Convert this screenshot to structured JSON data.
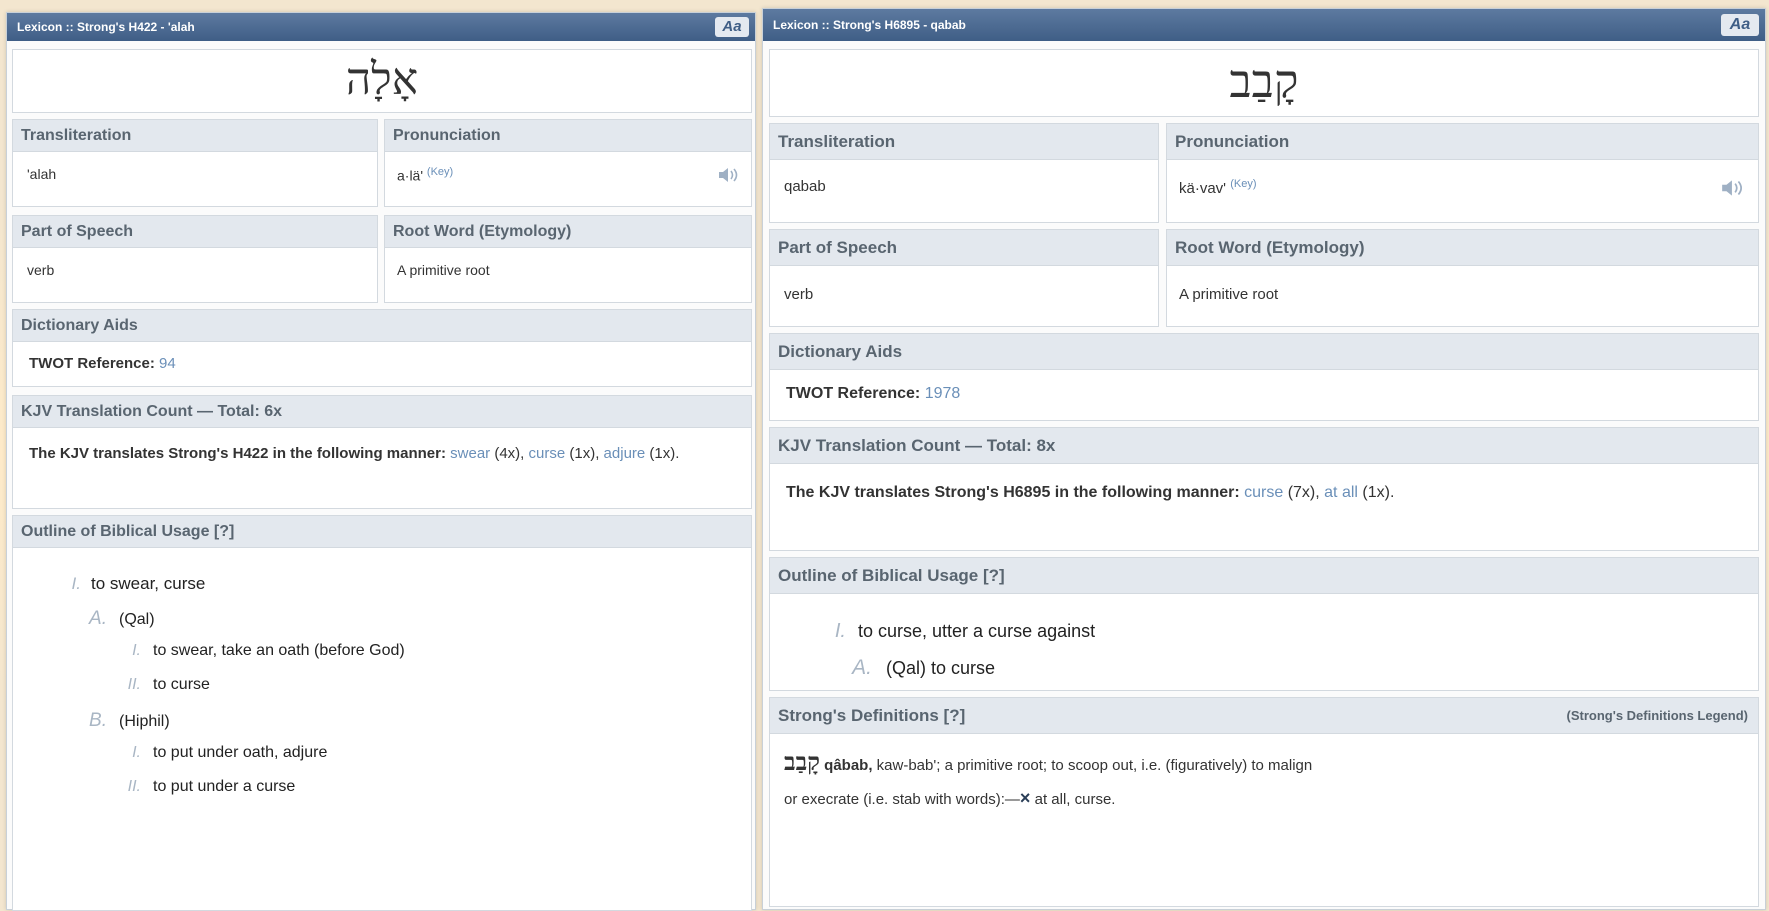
{
  "left": {
    "title": "Lexicon :: Strong's H422 - 'alah",
    "font_button": "Aa",
    "hebrew_word": "אָלָה",
    "transliteration_label": "Transliteration",
    "transliteration": "'alah",
    "pronunciation_label": "Pronunciation",
    "pronunciation": "a·lä'",
    "pronunciation_key": "(Key)",
    "pos_label": "Part of Speech",
    "pos": "verb",
    "root_label": "Root Word (Etymology)",
    "root": "A primitive root",
    "aids_label": "Dictionary Aids",
    "twot_label": "TWOT Reference:",
    "twot_value": "94",
    "kjv_label": "KJV Translation Count — Total: 6x",
    "kjv_intro": "The KJV translates Strong's H422 in the following manner:",
    "kjv_t1": "swear",
    "kjv_t1_count": " (4x),",
    "kjv_t2": "curse",
    "kjv_t2_count": " (1x),",
    "kjv_t3": "adjure",
    "kjv_t3_count": " (1x).",
    "outline_label": "Outline of Biblical Usage [?]",
    "outline": [
      {
        "num": "I.",
        "text": "to swear, curse"
      },
      {
        "num": "A.",
        "text": "(Qal)"
      },
      {
        "num": "I.",
        "text": "to swear, take an oath (before God)"
      },
      {
        "num": "II.",
        "text": "to curse"
      },
      {
        "num": "B.",
        "text": "(Hiphil)"
      },
      {
        "num": "I.",
        "text": "to put under oath, adjure"
      },
      {
        "num": "II.",
        "text": "to put under a curse"
      }
    ]
  },
  "right": {
    "title": "Lexicon :: Strong's H6895 - qabab",
    "font_button": "Aa",
    "hebrew_word": "קָבַב",
    "transliteration_label": "Transliteration",
    "transliteration": "qabab",
    "pronunciation_label": "Pronunciation",
    "pronunciation": "kä·vav'",
    "pronunciation_key": "(Key)",
    "pos_label": "Part of Speech",
    "pos": "verb",
    "root_label": "Root Word (Etymology)",
    "root": "A primitive root",
    "aids_label": "Dictionary Aids",
    "twot_label": "TWOT Reference:",
    "twot_value": "1978",
    "kjv_label": "KJV Translation Count — Total: 8x",
    "kjv_intro": "The KJV translates Strong's H6895 in the following manner:",
    "kjv_t1": "curse",
    "kjv_t1_count": " (7x),",
    "kjv_t2": "at all",
    "kjv_t2_count": " (1x).",
    "outline_label": "Outline of Biblical Usage [?]",
    "outline": [
      {
        "num": "I.",
        "text": "to curse, utter a curse against"
      },
      {
        "num": "A.",
        "text": "(Qal) to curse"
      }
    ],
    "strongs_label": "Strong's Definitions [?]",
    "strongs_legend": "(Strong's Definitions Legend)",
    "strongs_hebrew": "קָבַב",
    "strongs_word": "qâbab,",
    "strongs_def_1": " kaw-bab'; a primitive root; to scoop out, i.e. (figuratively) to malign",
    "strongs_def_2": "or execrate (i.e. stab with words):—",
    "strongs_x": "×",
    "strongs_def_3": " at all, curse."
  }
}
